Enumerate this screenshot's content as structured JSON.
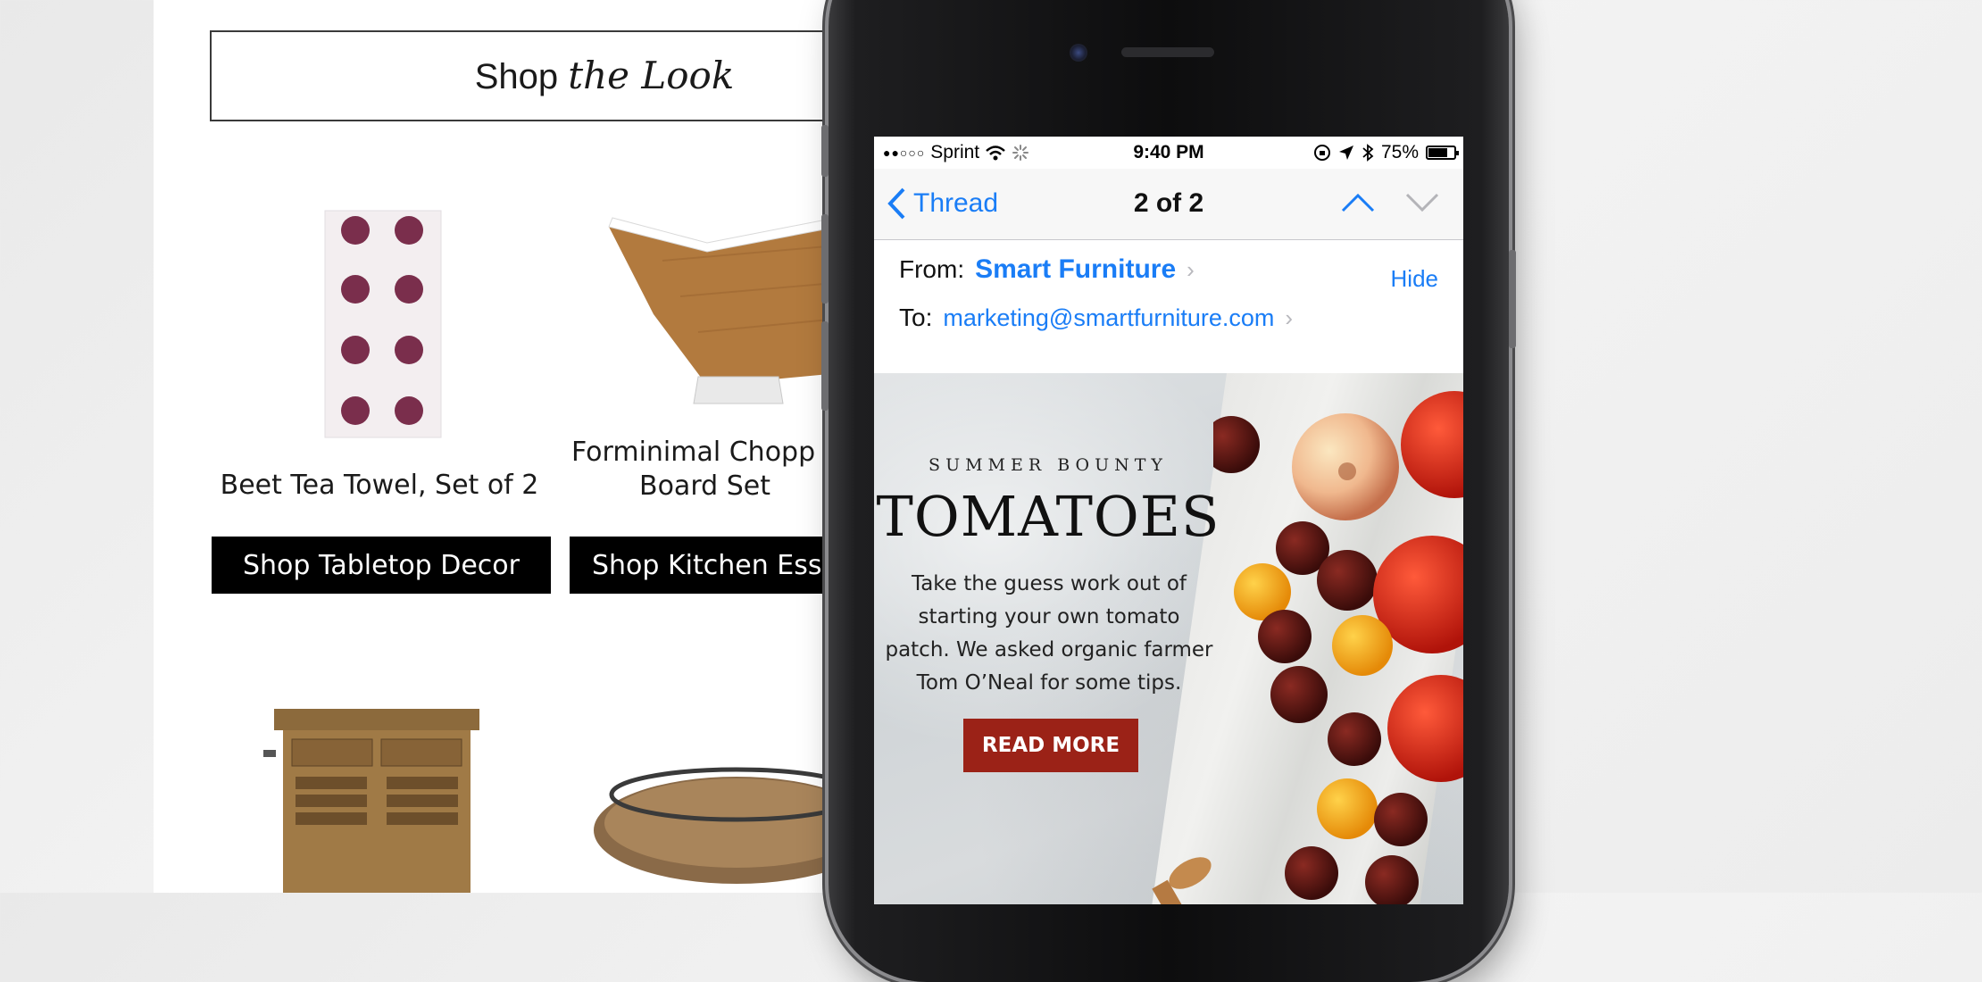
{
  "background_email": {
    "section_title": {
      "plain": "Shop",
      "script": "the Look"
    },
    "products": [
      {
        "name": "Beet Tea Towel, Set of 2",
        "button": "Shop Tabletop Decor"
      },
      {
        "name_line1": "Forminimal Chopp",
        "name_line2": "Board Set",
        "button": "Shop Kitchen Essen"
      }
    ]
  },
  "status_bar": {
    "carrier": "Sprint",
    "time": "9:40 PM",
    "battery": "75%",
    "battery_level": 0.75
  },
  "nav": {
    "back_label": "Thread",
    "title": "2 of 2"
  },
  "header": {
    "from_label": "From:",
    "sender": "Smart Furniture",
    "hide_label": "Hide",
    "to_label": "To:",
    "recipient": "marketing@smartfurniture.com"
  },
  "hero": {
    "eyebrow": "SUMMER BOUNTY",
    "headline": "TOMATOES",
    "body": "Take the guess work out of starting your own tomato patch. We asked organic farmer Tom O’Neal for some tips.",
    "cta_label": "READ MORE",
    "cta_color": "#9b2217"
  },
  "colors": {
    "ios_blue": "#1a7df6",
    "black_button": "#000000"
  }
}
